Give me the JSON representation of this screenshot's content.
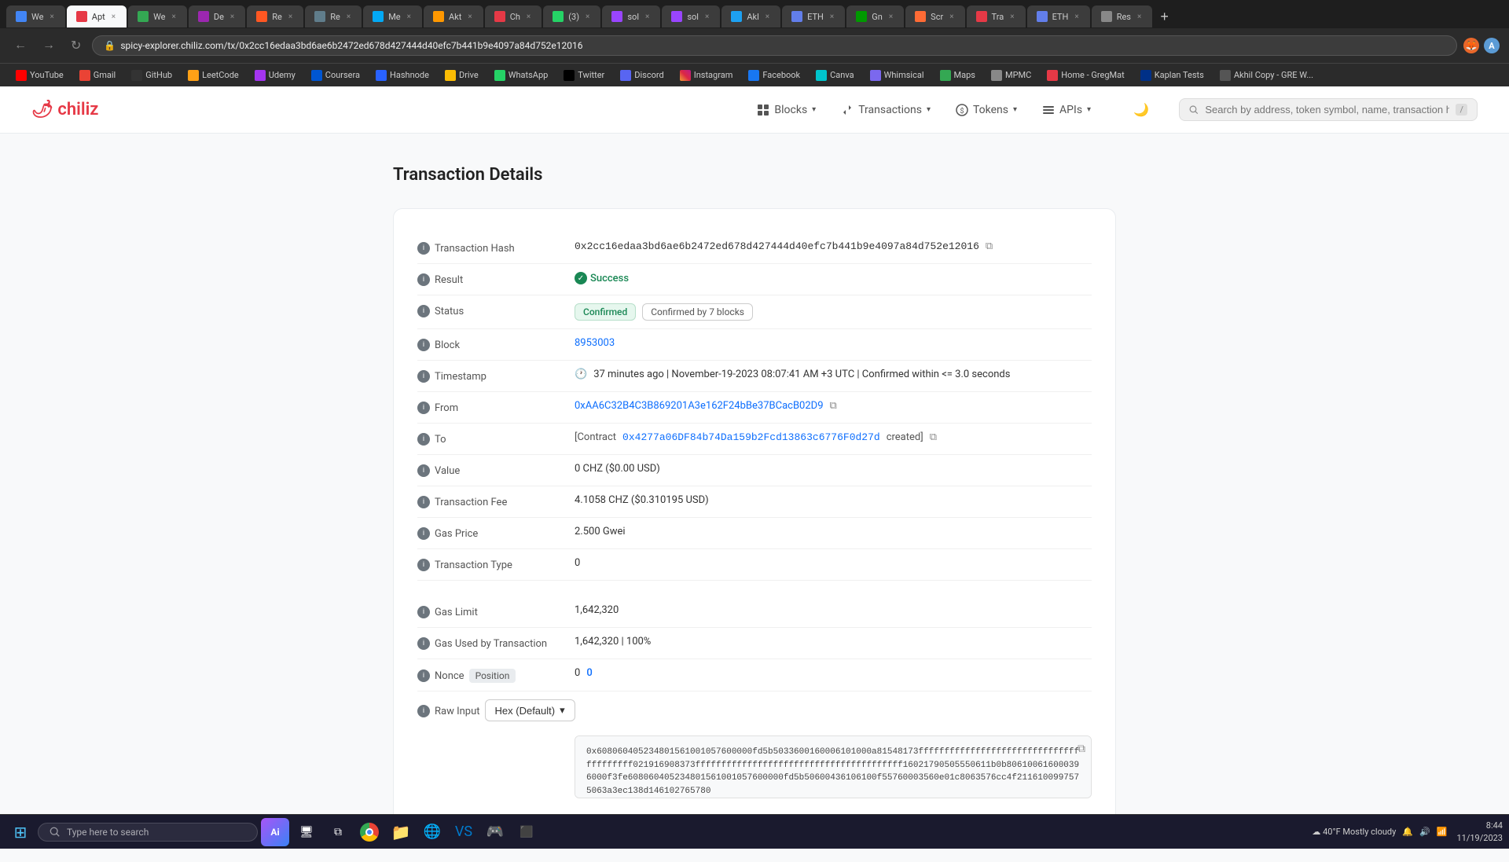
{
  "browser": {
    "url": "spicy-explorer.chiliz.com/tx/0x2cc16edaa3bd6ae6b2472ed678d427444d40efc7b441b9e4097a84d752e12016",
    "tabs": [
      {
        "label": "We",
        "active": false
      },
      {
        "label": "Apt",
        "active": true
      },
      {
        "label": "We",
        "active": false
      },
      {
        "label": "De",
        "active": false
      },
      {
        "label": "Re",
        "active": false
      },
      {
        "label": "Re",
        "active": false
      },
      {
        "label": "Me",
        "active": false
      },
      {
        "label": "Akt",
        "active": false
      },
      {
        "label": "Ch",
        "active": false
      },
      {
        "label": "(3)",
        "active": false
      },
      {
        "label": "sol",
        "active": false
      },
      {
        "label": "sol",
        "active": false
      },
      {
        "label": "Akl",
        "active": false
      },
      {
        "label": "ETH",
        "active": false
      },
      {
        "label": "Gn",
        "active": false
      },
      {
        "label": "Scr",
        "active": false
      },
      {
        "label": "Tra",
        "active": false
      },
      {
        "label": "ETH",
        "active": false
      },
      {
        "label": "Res",
        "active": false
      }
    ],
    "bookmarks": [
      "YouTube",
      "Gmail",
      "GitHub",
      "LeetCode",
      "Udemy",
      "Coursera",
      "Hashnode",
      "Drive",
      "WhatsApp",
      "Twitter",
      "Discord",
      "Instagram",
      "Facebook",
      "Canva",
      "Whimsical",
      "Maps",
      "MPMC",
      "Home - GregMat",
      "Kaplan Tests",
      "Akhil Copy - GRE W..."
    ]
  },
  "header": {
    "logo": "chiliz",
    "nav_items": [
      {
        "label": "Blocks",
        "icon": "grid"
      },
      {
        "label": "Transactions",
        "icon": "arrows"
      },
      {
        "label": "Tokens",
        "icon": "coin"
      },
      {
        "label": "APIs",
        "icon": "menu"
      }
    ],
    "search_placeholder": "Search by address, token symbol, name, transaction hash, or block number"
  },
  "page": {
    "title": "Transaction Details",
    "fields": {
      "transaction_hash": {
        "label": "Transaction Hash",
        "value": "0x2cc16edaa3bd6ae6b2472ed678d427444d40efc7b441b9e4097a84d752e12016"
      },
      "result": {
        "label": "Result",
        "value": "Success"
      },
      "status": {
        "label": "Status",
        "confirmed": "Confirmed",
        "confirmed_by": "Confirmed by 7 blocks"
      },
      "block": {
        "label": "Block",
        "value": "8953003"
      },
      "timestamp": {
        "label": "Timestamp",
        "value": "37 minutes ago | November-19-2023 08:07:41 AM +3 UTC | Confirmed within <= 3.0 seconds"
      },
      "from": {
        "label": "From",
        "value": "0xAA6C32B4C3B869201A3e162F24bBe37BCacB02D9"
      },
      "to": {
        "label": "To",
        "prefix": "[Contract",
        "address": "0x4277a06DF84b74Da159b2Fcd13863c6776F0d27d",
        "suffix": "created]"
      },
      "value": {
        "label": "Value",
        "value": "0 CHZ ($0.00 USD)"
      },
      "transaction_fee": {
        "label": "Transaction Fee",
        "value": "4.1058 CHZ ($0.310195 USD)"
      },
      "gas_price": {
        "label": "Gas Price",
        "value": "2.500 Gwei"
      },
      "transaction_type": {
        "label": "Transaction Type",
        "value": "0"
      },
      "gas_limit": {
        "label": "Gas Limit",
        "value": "1,642,320"
      },
      "gas_used": {
        "label": "Gas Used by Transaction",
        "value": "1,642,320 | 100%"
      },
      "nonce": {
        "label": "Nonce",
        "position_label": "Position",
        "nonce_value": "0",
        "position_value": "0"
      },
      "raw_input": {
        "label": "Raw Input",
        "format": "Hex (Default)",
        "value": "0x608060405234801561001057600000fd5b5033600160006101000a81548173ffffffffffffffffffffffffffffffffffffffff021916908373ffffffffffffffffffffffffffffffffffffffff16021790505550611b0b806100616000396000f3fe608060405234801561001057600000fd5b50600436106100f55760003560e01c8063576cc4f2116100997575063a3ec138d146102765780"
      }
    }
  },
  "taskbar": {
    "search_placeholder": "Type here to search",
    "ai_label": "Ai",
    "time": "8:44",
    "date": "11/19/2023",
    "weather": "40°F  Mostly cloudy"
  }
}
